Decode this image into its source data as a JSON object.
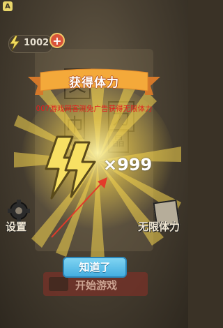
{
  "corner_badge": "A",
  "energy": {
    "count": "1002",
    "plus": "+"
  },
  "background_chars": [
    "文",
    "力",
    "巾",
    "晶"
  ],
  "popup": {
    "title": "获得体力",
    "watermark": "007游戏网客测免广告获得无限体力",
    "reward_multiplier": "×999",
    "ok_label": "知道了"
  },
  "menu": {
    "settings_label": "设置",
    "free_energy_label": "无限体力",
    "start_label": "开始游戏"
  },
  "colors": {
    "ribbon": "#f4a93a",
    "ribbon_dark": "#d5782a",
    "bolt": "#f7e063",
    "watermark": "#e21e1e",
    "ok_button": "#5ec0ea",
    "arrow": "#e33b2a"
  }
}
